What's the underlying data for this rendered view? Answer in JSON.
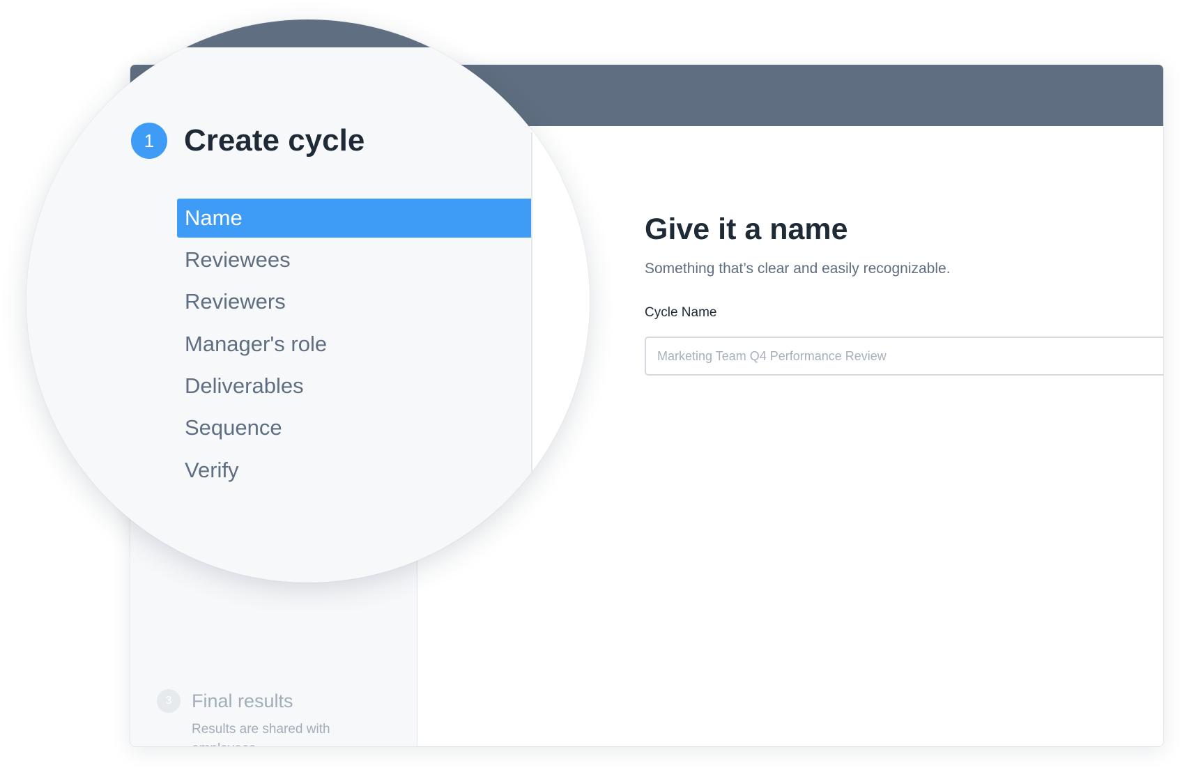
{
  "sidebar": {
    "final_step": {
      "number": "3",
      "title": "Final results",
      "description": "Results are shared with employees."
    }
  },
  "form": {
    "title": "Give it a name",
    "subtitle": "Something that’s clear and easily recognizable.",
    "cycle_name": {
      "label": "Cycle Name",
      "placeholder": "Marketing Team Q4 Performance Review",
      "value": ""
    }
  },
  "magnifier": {
    "step": {
      "number": "1",
      "title": "Create cycle"
    },
    "substeps": [
      {
        "label": "Name",
        "active": true
      },
      {
        "label": "Reviewees",
        "active": false
      },
      {
        "label": "Reviewers",
        "active": false
      },
      {
        "label": "Manager's role",
        "active": false
      },
      {
        "label": "Deliverables",
        "active": false
      },
      {
        "label": "Sequence",
        "active": false
      },
      {
        "label": "Verify",
        "active": false
      }
    ]
  },
  "colors": {
    "header": "#5f6e80",
    "accent": "#3e9cf6",
    "sidebar_bg": "#f7f8fa",
    "text_dark": "#1f2a37",
    "text_muted": "#5f6e80",
    "text_disabled": "#a3adb9"
  }
}
